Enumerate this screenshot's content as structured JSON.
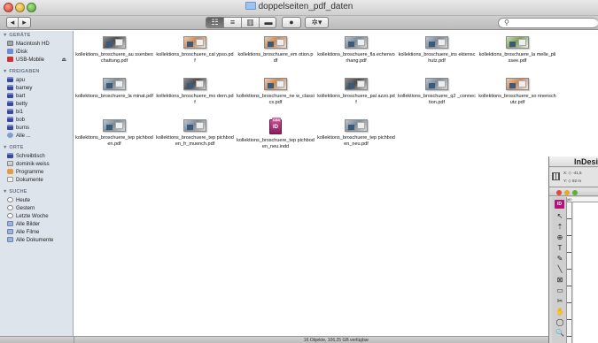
{
  "window": {
    "title": "doppelseiten_pdf_daten"
  },
  "toolbar": {
    "nav_back": "◂",
    "nav_forward": "▸",
    "view_modes": [
      "☷",
      "≡",
      "▥",
      "▬"
    ],
    "quicklook": "●",
    "action": "✲▾",
    "search_placeholder": ""
  },
  "sidebar": {
    "sections": [
      {
        "header": "▼ GERÄTE",
        "items": [
          {
            "label": "Macintosh HD",
            "icon": "disk-icon"
          },
          {
            "label": "iDisk",
            "icon": "idisk-icon"
          },
          {
            "label": "USB-Mobile",
            "icon": "usb-drive-icon",
            "eject": "⏏"
          }
        ]
      },
      {
        "header": "▼ FREIGABEN",
        "items": [
          {
            "label": "apu",
            "icon": "screen-icon"
          },
          {
            "label": "barney",
            "icon": "screen-icon"
          },
          {
            "label": "bart",
            "icon": "screen-icon"
          },
          {
            "label": "betty",
            "icon": "screen-icon"
          },
          {
            "label": "bi1",
            "icon": "screen-icon"
          },
          {
            "label": "bob",
            "icon": "screen-icon"
          },
          {
            "label": "burns",
            "icon": "screen-icon"
          },
          {
            "label": "Alle ...",
            "icon": "network-globe-icon"
          }
        ]
      },
      {
        "header": "▼ ORTE",
        "items": [
          {
            "label": "Schreibtisch",
            "icon": "desktop-icon"
          },
          {
            "label": "dominik-weiss",
            "icon": "home-icon"
          },
          {
            "label": "Programme",
            "icon": "applications-icon"
          },
          {
            "label": "Dokumente",
            "icon": "documents-icon"
          }
        ]
      },
      {
        "header": "▼ SUCHE",
        "items": [
          {
            "label": "Heute",
            "icon": "clock-icon"
          },
          {
            "label": "Gestern",
            "icon": "clock-icon"
          },
          {
            "label": "Letzte Woche",
            "icon": "clock-icon"
          },
          {
            "label": "Alle Bilder",
            "icon": "smart-folder-icon"
          },
          {
            "label": "Alle Filme",
            "icon": "smart-folder-icon"
          },
          {
            "label": "Alle Dokumente",
            "icon": "smart-folder-icon"
          }
        ]
      }
    ]
  },
  "files": [
    {
      "name": "kollektions_broschuere_au ssenbeschattung.pdf",
      "kind": "pdf",
      "tint": "dark"
    },
    {
      "name": "kollektions_broschuere_cal ypso.pdf",
      "kind": "pdf",
      "tint": "warm"
    },
    {
      "name": "kollektions_broschuere_em otion.pdf",
      "kind": "pdf",
      "tint": "warm"
    },
    {
      "name": "kollektions_broschuere_fla echenvorhang.pdf",
      "kind": "pdf",
      "tint": "plain"
    },
    {
      "name": "kollektions_broschuere_ins ektenschutz.pdf",
      "kind": "pdf",
      "tint": "plain"
    },
    {
      "name": "kollektions_broschuere_la melle_plissee.pdf",
      "kind": "pdf",
      "tint": "green"
    },
    {
      "name": "kollektions_broschuere_la minat.pdf",
      "kind": "pdf",
      "tint": "plain"
    },
    {
      "name": "kollektions_broschuere_mo dern.pdf",
      "kind": "pdf",
      "tint": "dark"
    },
    {
      "name": "kollektions_broschuere_ne w_classics.pdf",
      "kind": "pdf",
      "tint": "warm"
    },
    {
      "name": "kollektions_broschuere_pal azzo.pdf",
      "kind": "pdf",
      "tint": "dark"
    },
    {
      "name": "kollektions_broschuere_q2 _connection.pdf",
      "kind": "pdf",
      "tint": "plain"
    },
    {
      "name": "kollektions_broschuere_so nnenschutz.pdf",
      "kind": "pdf",
      "tint": "warm"
    },
    {
      "name": "kollektions_broschuere_tep pichboden.pdf",
      "kind": "pdf",
      "tint": "plain"
    },
    {
      "name": "kollektions_broschuere_tep pichboden_fr_muench.pdf",
      "kind": "pdf",
      "tint": "plain"
    },
    {
      "name": "kollektions_broschuere_tep pichboden_neu.indd",
      "kind": "indd",
      "tint": "plain",
      "badge": "CS3",
      "glyph": "ID"
    },
    {
      "name": "kollektions_broschuere_tep pichboden_neu.pdf",
      "kind": "pdf",
      "tint": "plain"
    }
  ],
  "status": "16 Objekte, 106,25 GB verfügbar",
  "indesign": {
    "app_name": "InDesi",
    "apple": "",
    "logo": "ID",
    "x_field": "X: ◇ -41,5",
    "y_field": "Y: ◇ 92 m",
    "ruler_top": "|80",
    "tools": [
      "↖",
      "⇡",
      "⊕",
      "T",
      "✎",
      "╲",
      "⊠",
      "▭",
      "✂",
      "✋",
      "◯",
      "🔍"
    ],
    "colors": {
      "brand": "#b2157a"
    }
  }
}
